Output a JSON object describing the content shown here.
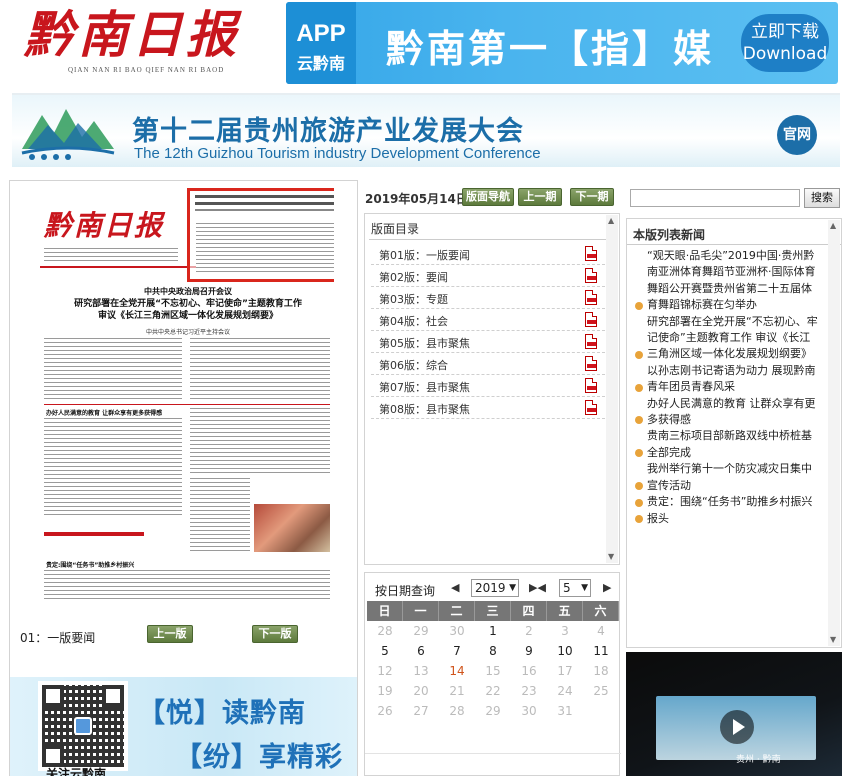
{
  "header": {
    "logo_text": "黔南日报",
    "logo_pinyin": "QIAN NAN RI BAO   QIEF NAN RI BAOD",
    "app_badge_top": "APP",
    "app_badge_bottom": "云黔南",
    "app_slogan": "黔南第一【指】媒",
    "download_line1": "立即下载",
    "download_line2": "Download"
  },
  "conference": {
    "title": "第十二届贵州旅游产业发展大会",
    "subtitle": "The 12th Guizhou Tourism industry  Development Conference",
    "official_site": "官网"
  },
  "page_view": {
    "paper_logo": "黔南日报",
    "headline1": "中共中央政治局召开会议",
    "headline2": "研究部署在全党开展“不忘初心、牢记使命”主题教育工作",
    "headline3": "审议《长江三角洲区域一体化发展规划纲要》",
    "headline4": "中共中央总书记习近平主持会议",
    "section_a": "办好人民满意的教育  让群众享有更多获得感",
    "section_b": "贵定:围绕“任务书”助推乡村振兴",
    "current_page_label": "01：一版要闻",
    "prev_label": "上一版",
    "next_label": "下一版"
  },
  "promo": {
    "line1": "【悦】读黔南",
    "line2": "【纷】享精彩",
    "line3": "关注云黔南"
  },
  "issue": {
    "date": "2019年05月14日",
    "nav_label": "版面导航",
    "prev_issue": "上一期",
    "next_issue": "下一期"
  },
  "toc": {
    "title": "版面目录",
    "items": [
      {
        "label": "第01版：一版要闻"
      },
      {
        "label": "第02版：要闻"
      },
      {
        "label": "第03版：专题"
      },
      {
        "label": "第04版：社会"
      },
      {
        "label": "第05版：县市聚焦"
      },
      {
        "label": "第06版：综合"
      },
      {
        "label": "第07版：县市聚焦"
      },
      {
        "label": "第08版：县市聚焦"
      }
    ]
  },
  "calendar": {
    "label": "按日期查询",
    "year": "2019",
    "month": "5",
    "weekdays": [
      "日",
      "一",
      "二",
      "三",
      "四",
      "五",
      "六"
    ],
    "weeks": [
      [
        {
          "d": "28",
          "on": false
        },
        {
          "d": "29",
          "on": false
        },
        {
          "d": "30",
          "on": false
        },
        {
          "d": "1",
          "on": true
        },
        {
          "d": "2",
          "on": false
        },
        {
          "d": "3",
          "on": false
        },
        {
          "d": "4",
          "on": false
        }
      ],
      [
        {
          "d": "5",
          "on": true
        },
        {
          "d": "6",
          "on": true
        },
        {
          "d": "7",
          "on": true
        },
        {
          "d": "8",
          "on": true
        },
        {
          "d": "9",
          "on": true
        },
        {
          "d": "10",
          "on": true
        },
        {
          "d": "11",
          "on": true
        }
      ],
      [
        {
          "d": "12",
          "on": false
        },
        {
          "d": "13",
          "on": false
        },
        {
          "d": "14",
          "on": true,
          "today": true
        },
        {
          "d": "15",
          "on": false
        },
        {
          "d": "16",
          "on": false
        },
        {
          "d": "17",
          "on": false
        },
        {
          "d": "18",
          "on": false
        }
      ],
      [
        {
          "d": "19",
          "on": false
        },
        {
          "d": "20",
          "on": false
        },
        {
          "d": "21",
          "on": false
        },
        {
          "d": "22",
          "on": false
        },
        {
          "d": "23",
          "on": false
        },
        {
          "d": "24",
          "on": false
        },
        {
          "d": "25",
          "on": false
        }
      ],
      [
        {
          "d": "26",
          "on": false
        },
        {
          "d": "27",
          "on": false
        },
        {
          "d": "28",
          "on": false
        },
        {
          "d": "29",
          "on": false
        },
        {
          "d": "30",
          "on": false
        },
        {
          "d": "31",
          "on": false
        },
        {
          "d": "",
          "on": false
        }
      ]
    ]
  },
  "search": {
    "placeholder": "",
    "button": "搜索"
  },
  "news": {
    "title": "本版列表新闻",
    "items": [
      "“观天眼·品毛尖”2019中国·贵州黔南亚洲体育舞蹈节亚洲杯·国际体育舞蹈公开赛暨贵州省第二十五届体育舞蹈锦标赛在匀举办",
      "研究部署在全党开展“不忘初心、牢记使命”主题教育工作 审议《长江三角洲区域一体化发展规划纲要》",
      "以孙志刚书记寄语为动力 展现黔南青年团员青春风采",
      "办好人民满意的教育 让群众享有更多获得感",
      "贵南三标项目部新路双线中桥桩基全部完成",
      "我州举行第十一个防灾减灾日集中宣传活动",
      "贵定：围绕“任务书”助推乡村振兴",
      "报头"
    ]
  },
  "video": {
    "caption": "贵州 · 黔南"
  },
  "colors": {
    "brand_red": "#c8161d",
    "nav_green": "#5d7a3c",
    "link_blue": "#1f71b8",
    "news_dot": "#e8a33a"
  }
}
